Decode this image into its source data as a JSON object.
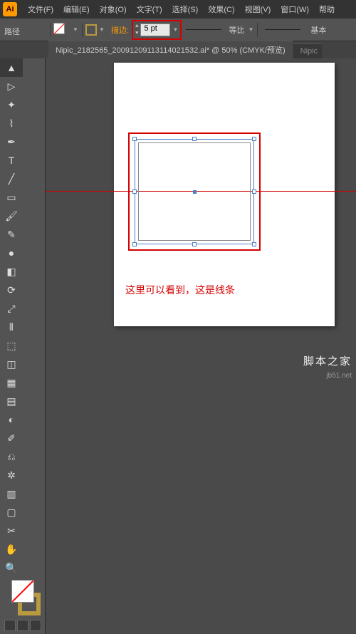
{
  "app": {
    "logo": "Ai"
  },
  "menu": [
    "文件(F)",
    "编辑(E)",
    "对象(O)",
    "文字(T)",
    "选择(S)",
    "效果(C)",
    "视图(V)",
    "窗口(W)",
    "帮助"
  ],
  "side_label": "路径",
  "toolbar": {
    "stroke_label": "描边:",
    "stroke_value": "5 pt",
    "profile_label": "等比",
    "style_label": "基本"
  },
  "tabs": {
    "active": "Nipic_2182565_20091209113114021532.ai* @ 50% (CMYK/预览)",
    "inactive": "Nipic"
  },
  "tools": {
    "items": [
      "selection",
      "direct-selection",
      "magic-wand",
      "lasso",
      "pen",
      "type",
      "line",
      "rectangle",
      "paintbrush",
      "pencil",
      "blob-brush",
      "eraser",
      "rotate",
      "scale",
      "width",
      "free-transform",
      "shape-builder",
      "perspective",
      "mesh",
      "gradient",
      "eyedropper",
      "blend",
      "symbol-sprayer",
      "graph",
      "artboard",
      "slice",
      "hand",
      "zoom"
    ],
    "glyphs": [
      "▲",
      "▷",
      "✦",
      "⌇",
      "✒",
      "T",
      "╱",
      "▭",
      "🖌",
      "✎",
      "●",
      "◧",
      "⟳",
      "⤢",
      "⫴",
      "⬚",
      "◫",
      "▦",
      "▤",
      "◐",
      "✐",
      "⎌",
      "✲",
      "▥",
      "▢",
      "✂",
      "✋",
      "🔍"
    ]
  },
  "annotation": "这里可以看到，这是线条",
  "footer": "脚本之家",
  "watermark": "jb51.net"
}
